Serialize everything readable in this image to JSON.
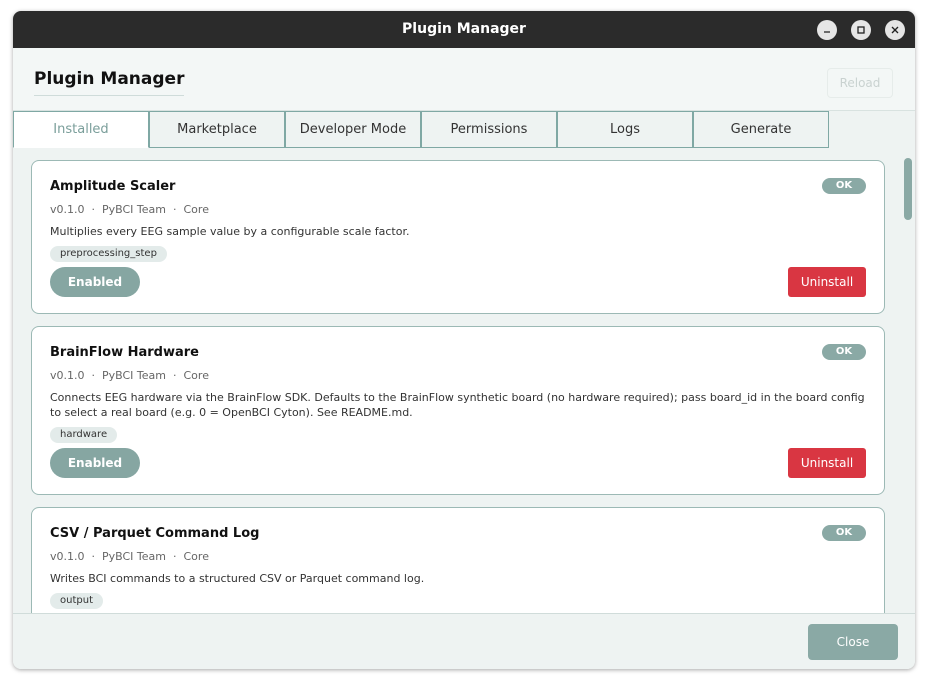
{
  "window": {
    "title": "Plugin Manager",
    "controls": [
      "minimize-icon",
      "maximize-icon",
      "close-icon"
    ]
  },
  "header": {
    "title": "Plugin Manager",
    "reload_label": "Reload"
  },
  "tabs": [
    {
      "label": "Installed",
      "active": true
    },
    {
      "label": "Marketplace",
      "active": false
    },
    {
      "label": "Developer Mode",
      "active": false
    },
    {
      "label": "Permissions",
      "active": false
    },
    {
      "label": "Logs",
      "active": false
    },
    {
      "label": "Generate",
      "active": false
    }
  ],
  "plugins": [
    {
      "name": "Amplitude Scaler",
      "version": "v0.1.0",
      "author": "PyBCI Team",
      "category": "Core",
      "description": "Multiplies every EEG sample value by a configurable scale factor.",
      "tag": "preprocessing_step",
      "status": "OK",
      "enabled_label": "Enabled",
      "uninstall_label": "Uninstall"
    },
    {
      "name": "BrainFlow Hardware",
      "version": "v0.1.0",
      "author": "PyBCI Team",
      "category": "Core",
      "description": "Connects EEG hardware via the BrainFlow SDK. Defaults to the BrainFlow synthetic board (no hardware required); pass board_id in the board config to select a real board (e.g. 0 = OpenBCI Cyton). See README.md.",
      "tag": "hardware",
      "status": "OK",
      "enabled_label": "Enabled",
      "uninstall_label": "Uninstall"
    },
    {
      "name": "CSV / Parquet Command Log",
      "version": "v0.1.0",
      "author": "PyBCI Team",
      "category": "Core",
      "description": "Writes BCI commands to a structured CSV or Parquet command log.",
      "tag": "output",
      "status": "OK"
    }
  ],
  "meta_separator": "·",
  "footer": {
    "close_label": "Close"
  },
  "colors": {
    "accent": "#8aa9a5",
    "danger": "#d93642",
    "titlebar": "#2b2b2b"
  }
}
